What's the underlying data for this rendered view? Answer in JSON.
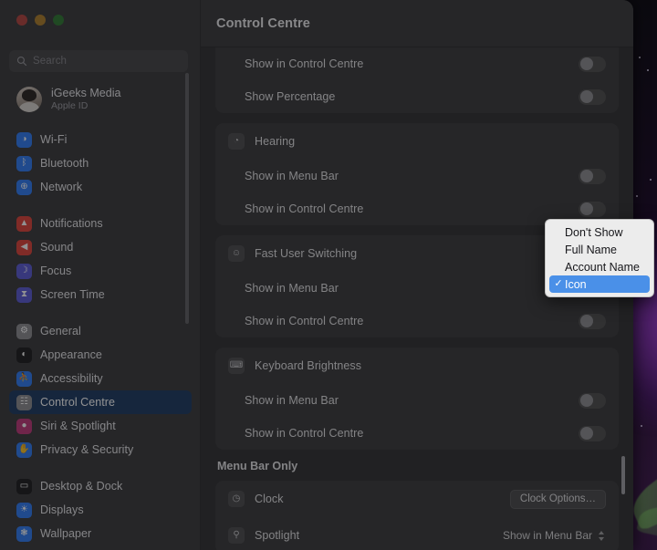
{
  "window": {
    "traffic_lights": [
      "close",
      "minimize",
      "zoom"
    ]
  },
  "sidebar": {
    "search": {
      "placeholder": "Search",
      "value": "",
      "icon": "search-icon"
    },
    "account": {
      "name": "iGeeks Media",
      "subtitle": "Apple ID",
      "icon": "avatar"
    },
    "groups": [
      {
        "items": [
          {
            "label": "Wi-Fi",
            "icon": "wifi-icon",
            "color": "#2f7cf6",
            "glyph": "◑",
            "selected": false
          },
          {
            "label": "Bluetooth",
            "icon": "bluetooth-icon",
            "color": "#2f7cf6",
            "glyph": "ᛒ",
            "selected": false
          },
          {
            "label": "Network",
            "icon": "network-icon",
            "color": "#2f7cf6",
            "glyph": "⊕",
            "selected": false
          }
        ]
      },
      {
        "items": [
          {
            "label": "Notifications",
            "icon": "notifications-icon",
            "color": "#e0433a",
            "glyph": "▲",
            "selected": false
          },
          {
            "label": "Sound",
            "icon": "sound-icon",
            "color": "#e0433a",
            "glyph": "◀",
            "selected": false
          },
          {
            "label": "Focus",
            "icon": "focus-icon",
            "color": "#5b5bd6",
            "glyph": "☽",
            "selected": false
          },
          {
            "label": "Screen Time",
            "icon": "screen-time-icon",
            "color": "#5b5bd6",
            "glyph": "⧗",
            "selected": false
          }
        ]
      },
      {
        "items": [
          {
            "label": "General",
            "icon": "general-icon",
            "color": "#8e8e93",
            "glyph": "⚙",
            "selected": false
          },
          {
            "label": "Appearance",
            "icon": "appearance-icon",
            "color": "#1c1c1e",
            "glyph": "◐",
            "selected": false
          },
          {
            "label": "Accessibility",
            "icon": "accessibility-icon",
            "color": "#2f7cf6",
            "glyph": "⛹",
            "selected": false
          },
          {
            "label": "Control Centre",
            "icon": "control-centre-icon",
            "color": "#8e8e93",
            "glyph": "☷",
            "selected": true
          },
          {
            "label": "Siri & Spotlight",
            "icon": "siri-icon",
            "color": "#c0397a",
            "glyph": "●",
            "selected": false
          },
          {
            "label": "Privacy & Security",
            "icon": "privacy-icon",
            "color": "#2f7cf6",
            "glyph": "✋",
            "selected": false
          }
        ]
      },
      {
        "items": [
          {
            "label": "Desktop & Dock",
            "icon": "desktop-dock-icon",
            "color": "#1c1c1e",
            "glyph": "▭",
            "selected": false
          },
          {
            "label": "Displays",
            "icon": "displays-icon",
            "color": "#2f7cf6",
            "glyph": "☀",
            "selected": false
          },
          {
            "label": "Wallpaper",
            "icon": "wallpaper-icon",
            "color": "#2f7cf6",
            "glyph": "❃",
            "selected": false
          }
        ]
      }
    ]
  },
  "main": {
    "title": "Control Centre",
    "sections": [
      {
        "name": "battery-continued",
        "rows": [
          {
            "label": "Show in Control Centre",
            "control": "toggle",
            "toggle_on": false,
            "indent": true
          },
          {
            "label": "Show Percentage",
            "control": "toggle",
            "toggle_on": false,
            "indent": true
          }
        ]
      },
      {
        "name": "hearing",
        "header": {
          "label": "Hearing",
          "icon": "hearing-icon",
          "glyph": "◔"
        },
        "rows": [
          {
            "label": "Show in Menu Bar",
            "control": "toggle",
            "toggle_on": false,
            "indent": true
          },
          {
            "label": "Show in Control Centre",
            "control": "toggle",
            "toggle_on": false,
            "indent": true
          }
        ]
      },
      {
        "name": "fast-user-switching",
        "header": {
          "label": "Fast User Switching",
          "icon": "fast-user-switching-icon",
          "glyph": "☺"
        },
        "rows": [
          {
            "label": "Show in Menu Bar",
            "control": "popup",
            "popup_value": "Icon",
            "indent": true
          },
          {
            "label": "Show in Control Centre",
            "control": "toggle",
            "toggle_on": false,
            "indent": true
          }
        ]
      },
      {
        "name": "keyboard-brightness",
        "header": {
          "label": "Keyboard Brightness",
          "icon": "keyboard-brightness-icon",
          "glyph": "⌨"
        },
        "rows": [
          {
            "label": "Show in Menu Bar",
            "control": "toggle",
            "toggle_on": false,
            "indent": true
          },
          {
            "label": "Show in Control Centre",
            "control": "toggle",
            "toggle_on": false,
            "indent": true
          }
        ]
      }
    ],
    "menu_bar_only": {
      "title": "Menu Bar Only",
      "rows": [
        {
          "label": "Clock",
          "icon": "clock-icon",
          "glyph": "◷",
          "control": "button",
          "button_label": "Clock Options…"
        },
        {
          "label": "Spotlight",
          "icon": "spotlight-icon",
          "glyph": "⚲",
          "control": "popup",
          "popup_value": "Show in Menu Bar"
        }
      ]
    }
  },
  "popup_menu": {
    "name": "fast-user-switching-menu-bar-popup",
    "selected": "Icon",
    "items": [
      {
        "label": "Don't Show",
        "selected": false
      },
      {
        "label": "Full Name",
        "selected": false
      },
      {
        "label": "Account Name",
        "selected": false
      },
      {
        "label": "Icon",
        "selected": true
      }
    ],
    "check_glyph": "✓",
    "highlight_color": "#4a90e8"
  }
}
